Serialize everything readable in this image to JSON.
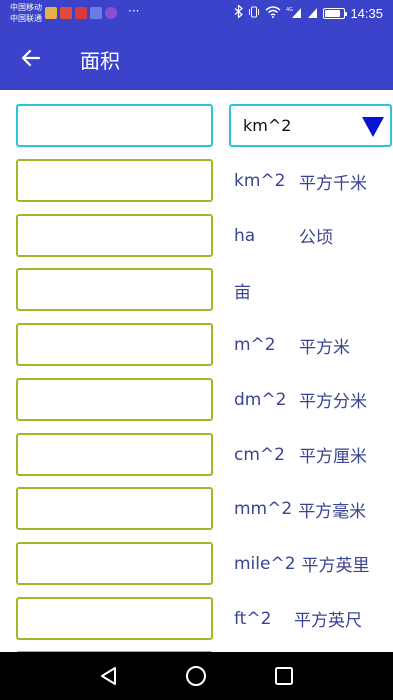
{
  "status_bar": {
    "carrier_1": "中国移动",
    "carrier_2": "中国联通",
    "more": "···",
    "network": "4G",
    "time": "14:35",
    "battery_level": 0.85
  },
  "app_bar": {
    "title": "面积"
  },
  "unit_select": {
    "selected": "km^2"
  },
  "units": [
    {
      "abbr": "km^2",
      "name": "平方千米"
    },
    {
      "abbr": "ha",
      "name": "公顷"
    },
    {
      "abbr": "",
      "name": "亩"
    },
    {
      "abbr": "m^2",
      "name": "平方米"
    },
    {
      "abbr": "dm^2",
      "name": "平方分米"
    },
    {
      "abbr": "cm^2",
      "name": "平方厘米"
    },
    {
      "abbr": "mm^2",
      "name": "平方毫米"
    },
    {
      "abbr": "mile^2",
      "name": "平方英里"
    },
    {
      "abbr": "ft^2",
      "name": "平方英尺"
    }
  ],
  "inputs": {
    "source_value": "",
    "values": [
      "",
      "",
      "",
      "",
      "",
      "",
      "",
      "",
      "",
      ""
    ]
  },
  "colors": {
    "primary": "#3a43c9",
    "input_border": "#9bbb26",
    "active_border": "#29c6d8",
    "unit_text": "#3a4490",
    "dropdown_arrow": "#0a12d6"
  }
}
